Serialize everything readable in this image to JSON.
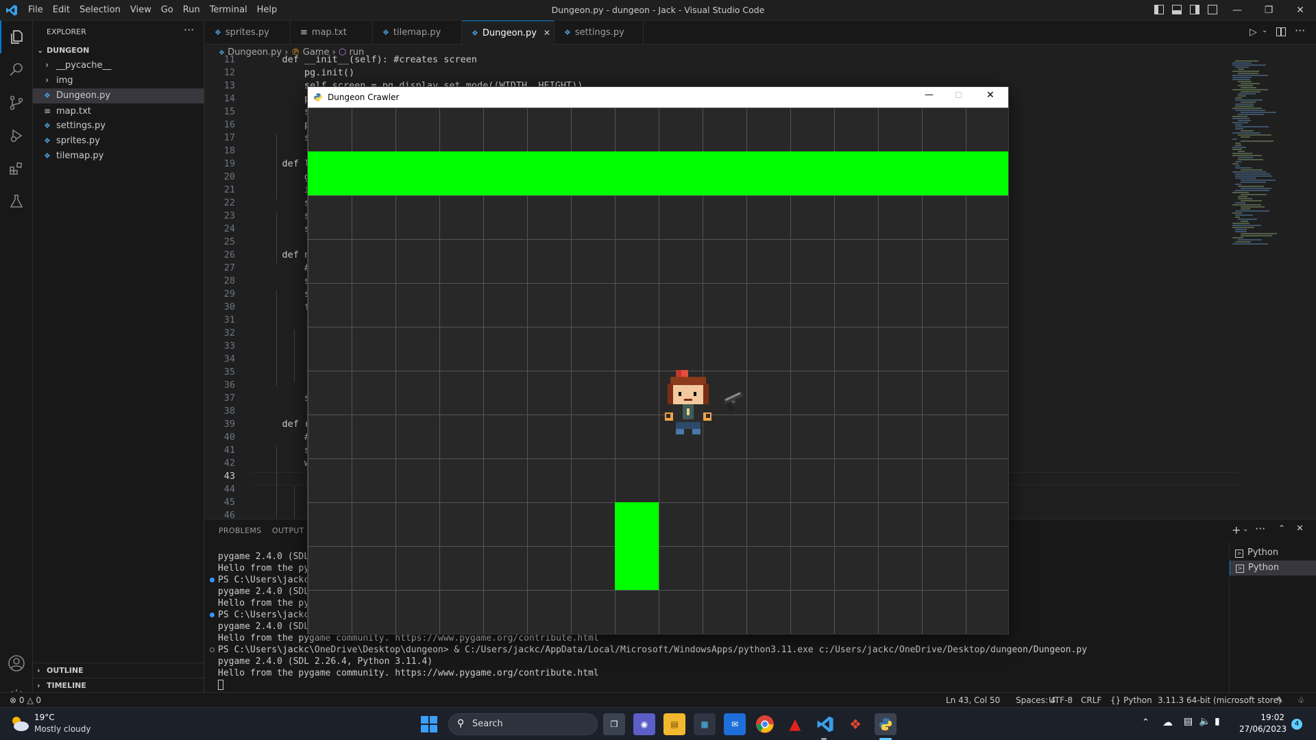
{
  "window": {
    "title": "Dungeon.py - dungeon - Jack - Visual Studio Code",
    "menu": [
      "File",
      "Edit",
      "Selection",
      "View",
      "Go",
      "Run",
      "Terminal",
      "Help"
    ]
  },
  "explorer": {
    "header": "EXPLORER",
    "root": "DUNGEON",
    "items": [
      {
        "label": "__pycache__",
        "type": "folder"
      },
      {
        "label": "img",
        "type": "folder"
      },
      {
        "label": "Dungeon.py",
        "type": "py",
        "selected": true
      },
      {
        "label": "map.txt",
        "type": "txt"
      },
      {
        "label": "settings.py",
        "type": "py"
      },
      {
        "label": "sprites.py",
        "type": "py"
      },
      {
        "label": "tilemap.py",
        "type": "py"
      }
    ],
    "outline": "OUTLINE",
    "timeline": "TIMELINE"
  },
  "tabs": [
    {
      "label": "sprites.py",
      "icon": "python-icon"
    },
    {
      "label": "map.txt",
      "icon": "text-file-icon"
    },
    {
      "label": "tilemap.py",
      "icon": "python-icon"
    },
    {
      "label": "Dungeon.py",
      "icon": "python-icon",
      "active": true,
      "close": "✕"
    },
    {
      "label": "settings.py",
      "icon": "python-icon"
    }
  ],
  "breadcrumb": [
    "Dungeon.py",
    "Game",
    "run"
  ],
  "editor": {
    "current_line": "43",
    "lines": [
      {
        "n": "11",
        "text": "    def __init__(self): #creates screen"
      },
      {
        "n": "12",
        "text": "        pg.init()"
      },
      {
        "n": "13",
        "text": "        self.screen = pg.display.set_mode((WIDTH, HEIGHT))"
      },
      {
        "n": "14",
        "text": "        pg"
      },
      {
        "n": "15",
        "text": "        sel"
      },
      {
        "n": "16",
        "text": "        pg."
      },
      {
        "n": "17",
        "text": "        sel"
      },
      {
        "n": "18",
        "text": ""
      },
      {
        "n": "19",
        "text": "    def loa"
      },
      {
        "n": "20",
        "text": "        gam"
      },
      {
        "n": "21",
        "text": "        img"
      },
      {
        "n": "22",
        "text": "        sel"
      },
      {
        "n": "23",
        "text": "        sel"
      },
      {
        "n": "24",
        "text": "        sel"
      },
      {
        "n": "25",
        "text": ""
      },
      {
        "n": "26",
        "text": "    def new"
      },
      {
        "n": "27",
        "text": "        # i"
      },
      {
        "n": "28",
        "text": "        sel"
      },
      {
        "n": "29",
        "text": "        sel"
      },
      {
        "n": "30",
        "text": "        for"
      },
      {
        "n": "31",
        "text": ""
      },
      {
        "n": "32",
        "text": ""
      },
      {
        "n": "33",
        "text": ""
      },
      {
        "n": "34",
        "text": ""
      },
      {
        "n": "35",
        "text": ""
      },
      {
        "n": "36",
        "text": ""
      },
      {
        "n": "37",
        "text": "        sel"
      },
      {
        "n": "38",
        "text": ""
      },
      {
        "n": "39",
        "text": "    def run"
      },
      {
        "n": "40",
        "text": "        # g"
      },
      {
        "n": "41",
        "text": "        sel"
      },
      {
        "n": "42",
        "text": "        whi"
      },
      {
        "n": "43",
        "text": ""
      },
      {
        "n": "44",
        "text": ""
      },
      {
        "n": "45",
        "text": ""
      },
      {
        "n": "46",
        "text": ""
      }
    ]
  },
  "panel": {
    "tabs": [
      "PROBLEMS",
      "OUTPUT"
    ],
    "terminal_lines": [
      {
        "text": "pygame 2.4.0 (SDL 2",
        "dot": false
      },
      {
        "text": "Hello from the pyga",
        "dot": false
      },
      {
        "text": "PS C:\\Users\\jackc\\O",
        "dot": true
      },
      {
        "text": "pygame 2.4.0 (SDL 2",
        "dot": false
      },
      {
        "text": "Hello from the pyga",
        "dot": false
      },
      {
        "text": "PS C:\\Users\\jackc\\O",
        "dot": true
      },
      {
        "text": "pygame 2.4.0 (SDL 2",
        "dot": false
      },
      {
        "text": "Hello from the pygame community. https://www.pygame.org/contribute.html",
        "dot": false
      },
      {
        "text": "PS C:\\Users\\jackc\\OneDrive\\Desktop\\dungeon> & C:/Users/jackc/AppData/Local/Microsoft/WindowsApps/python3.11.exe c:/Users/jackc/OneDrive/Desktop/dungeon/Dungeon.py",
        "dot": "hollow"
      },
      {
        "text": "pygame 2.4.0 (SDL 2.26.4, Python 3.11.4)",
        "dot": false
      },
      {
        "text": "Hello from the pygame community. https://www.pygame.org/contribute.html",
        "dot": false
      }
    ],
    "terminals": [
      "Python",
      "Python"
    ]
  },
  "status": {
    "errors": "0",
    "warnings": "0",
    "position": "Ln 43, Col 50",
    "spaces": "Spaces: 4",
    "encoding": "UTF-8",
    "eol": "CRLF",
    "language": "Python",
    "interpreter": "3.11.3 64-bit (microsoft store)"
  },
  "game": {
    "title": "Dungeon Crawler",
    "wall_color": "#00ff00",
    "grid_color": "#555555",
    "bg_color": "#282828"
  },
  "taskbar": {
    "weather_temp": "19°C",
    "weather_desc": "Mostly cloudy",
    "search": "Search",
    "time": "19:02",
    "date": "27/06/2023",
    "notifications": "4"
  }
}
